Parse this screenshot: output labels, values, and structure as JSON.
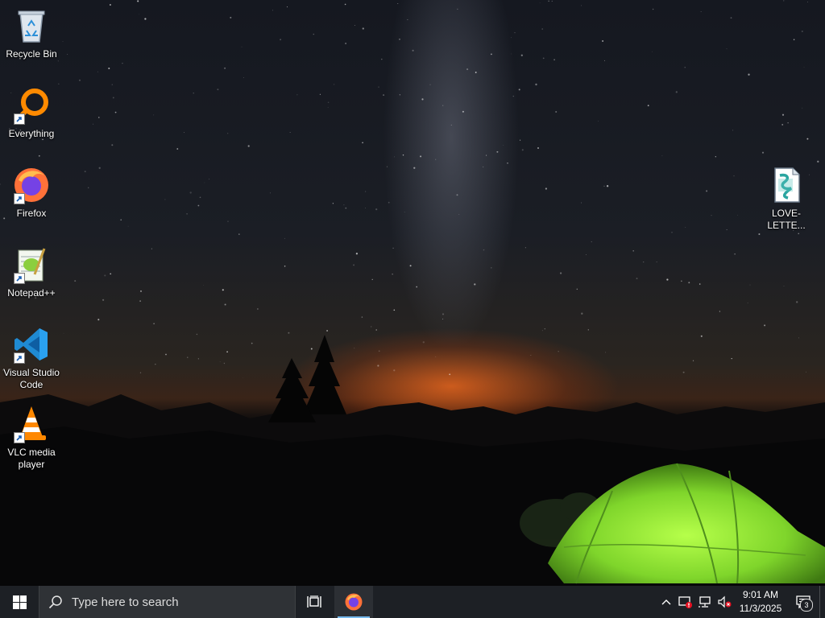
{
  "desktop": {
    "icons_left": [
      {
        "label": "Recycle Bin",
        "icon": "recycle-bin-icon",
        "shortcut": false
      },
      {
        "label": "Everything",
        "icon": "everything-icon",
        "shortcut": true
      },
      {
        "label": "Firefox",
        "icon": "firefox-icon",
        "shortcut": true
      },
      {
        "label": "Notepad++",
        "icon": "notepad-plus-plus-icon",
        "shortcut": true
      },
      {
        "label": "Visual Studio Code",
        "icon": "vscode-icon",
        "shortcut": true
      },
      {
        "label": "VLC media player",
        "icon": "vlc-icon",
        "shortcut": true
      }
    ],
    "file_icon": {
      "label": "LOVE-LETTE...",
      "icon": "vbs-script-icon"
    }
  },
  "taskbar": {
    "start_icon": "windows-logo-icon",
    "search": {
      "placeholder": "Type here to search",
      "icon": "search-icon"
    },
    "task_view_icon": "task-view-icon",
    "pinned": [
      {
        "name": "Firefox",
        "icon": "firefox-icon",
        "active": true
      }
    ],
    "tray": {
      "icons": [
        "chevron-up-icon",
        "security-alert-icon",
        "network-icon",
        "volume-muted-icon"
      ],
      "time": "9:01 AM",
      "date": "11/3/2025",
      "notification_count": "3"
    }
  },
  "colors": {
    "taskbar_bg": "#1d2025",
    "search_bg": "#2f3236",
    "accent": "#76b9ed",
    "tent_green": "#8ee03a"
  }
}
